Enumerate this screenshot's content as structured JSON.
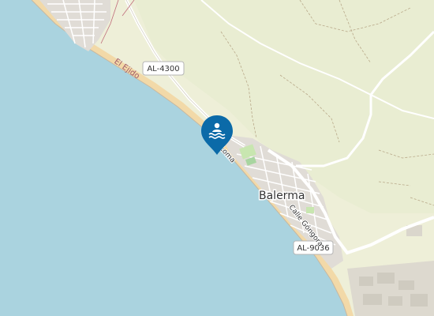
{
  "map": {
    "labels": {
      "town": "Balerma",
      "district": "El Ejido",
      "road_al4300": "AL-4300",
      "road_al9036": "AL-9036",
      "street_gongora": "Calle Góngora",
      "street_loma": "Loma"
    },
    "marker": {
      "icon": "swimming-icon",
      "color": "#0b6aa8"
    },
    "colors": {
      "sea": "#aad3df",
      "land": "#f0f0dc",
      "beach": "#f2d9a8",
      "urban": "#e2dcd5",
      "road_label_fill": "#ffffff"
    }
  }
}
